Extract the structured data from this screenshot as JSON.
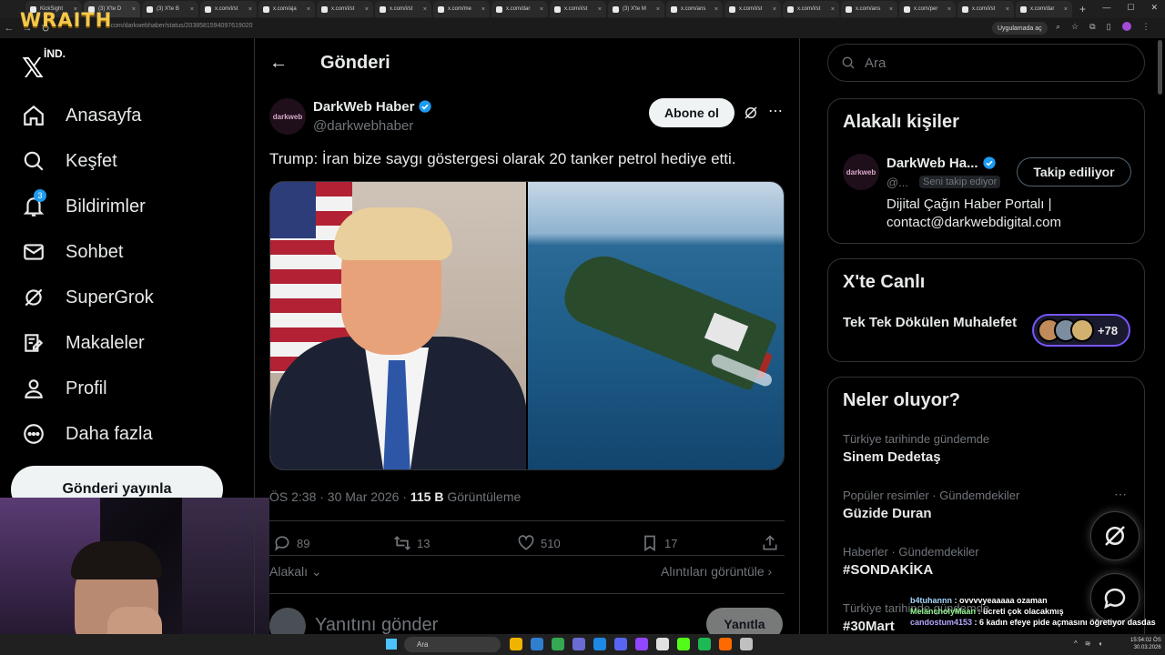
{
  "overlay": {
    "streamer_logo": "WRAITH"
  },
  "browser": {
    "tabs": [
      "KickSight",
      "(3) X'te D",
      "(3) X'te B",
      "x.com/i/st",
      "x.com/aja",
      "x.com/i/st",
      "x.com/i/st",
      "x.com/me",
      "x.com/dar",
      "x.com/i/st",
      "(3) X'te M",
      "x.com/ans",
      "x.com/i/st",
      "x.com/i/st",
      "x.com/ans",
      "x.com/per",
      "x.com/i/st",
      "x.com/dar"
    ],
    "url": "x.com/darkwebhaber/status/2038581594097619020",
    "app_button": "Uygulamada aç"
  },
  "leftnav": {
    "logo_sup": "İND.",
    "items": [
      {
        "label": "Anasayfa",
        "icon": "home-icon"
      },
      {
        "label": "Keşfet",
        "icon": "search-icon"
      },
      {
        "label": "Bildirimler",
        "icon": "bell-icon",
        "badge": "3"
      },
      {
        "label": "Sohbet",
        "icon": "mail-icon"
      },
      {
        "label": "SuperGrok",
        "icon": "grok-icon"
      },
      {
        "label": "Makaleler",
        "icon": "article-icon"
      },
      {
        "label": "Profil",
        "icon": "user-icon"
      },
      {
        "label": "Daha fazla",
        "icon": "more-circle-icon"
      }
    ],
    "post_button": "Gönderi yayınla"
  },
  "center": {
    "header_title": "Gönderi",
    "author": {
      "name": "DarkWeb Haber",
      "handle": "@darkwebhaber",
      "avatar_text": "darkweb"
    },
    "follow_label": "Abone ol",
    "tweet_text": "Trump: İran bize saygı göstergesi olarak 20 tanker petrol hediye etti.",
    "meta": {
      "time": "ÖS 2:38 · 30 Mar 2026 · ",
      "views": "115 B",
      "views_label": " Görüntüleme"
    },
    "actions": {
      "replies": "89",
      "reposts": "13",
      "likes": "510",
      "bookmarks": "17"
    },
    "relevant_label": "Alakalı",
    "quotes_label": "Alıntıları görüntüle",
    "reply_placeholder": "Yanıtını gönder",
    "reply_button": "Yanıtla"
  },
  "right": {
    "search_placeholder": "Ara",
    "relevant_people": {
      "title": "Alakalı kişiler",
      "name": "DarkWeb Ha...",
      "handle": "@...",
      "follows_you": "Seni takip ediyor",
      "follow_button": "Takip ediliyor",
      "bio": "Dijital Çağın Haber Portalı | contact@darkwebdigital.com"
    },
    "live": {
      "title": "X'te Canlı",
      "space_title": "Tek Tek Dökülen Muhalefet",
      "count": "+78"
    },
    "trends": {
      "title": "Neler oluyor?",
      "items": [
        {
          "meta": "Türkiye tarihinde gündemde",
          "name": "Sinem Dedetaş"
        },
        {
          "meta": "Popüler resimler · Gündemdekiler",
          "name": "Güzide Duran"
        },
        {
          "meta": "Haberler · Gündemdekiler",
          "name": "#SONDAKİKA"
        },
        {
          "meta": "Türkiye tarihinde gündemde",
          "name": "#30Mart"
        }
      ]
    }
  },
  "chat": [
    {
      "user": "b4tuhannn",
      "text": " : ovvvvyeaaaaa ozaman"
    },
    {
      "user": "MelancholyMaan",
      "text": " : ücreti çok olacakmış"
    },
    {
      "user": "candostum4153",
      "text": " : 6 kadın efeye pide açmasını öğretiyor dasdas"
    }
  ],
  "taskbar": {
    "search": "Ara",
    "time": "15:54:02 ÖS",
    "date": "30.03.2026"
  }
}
